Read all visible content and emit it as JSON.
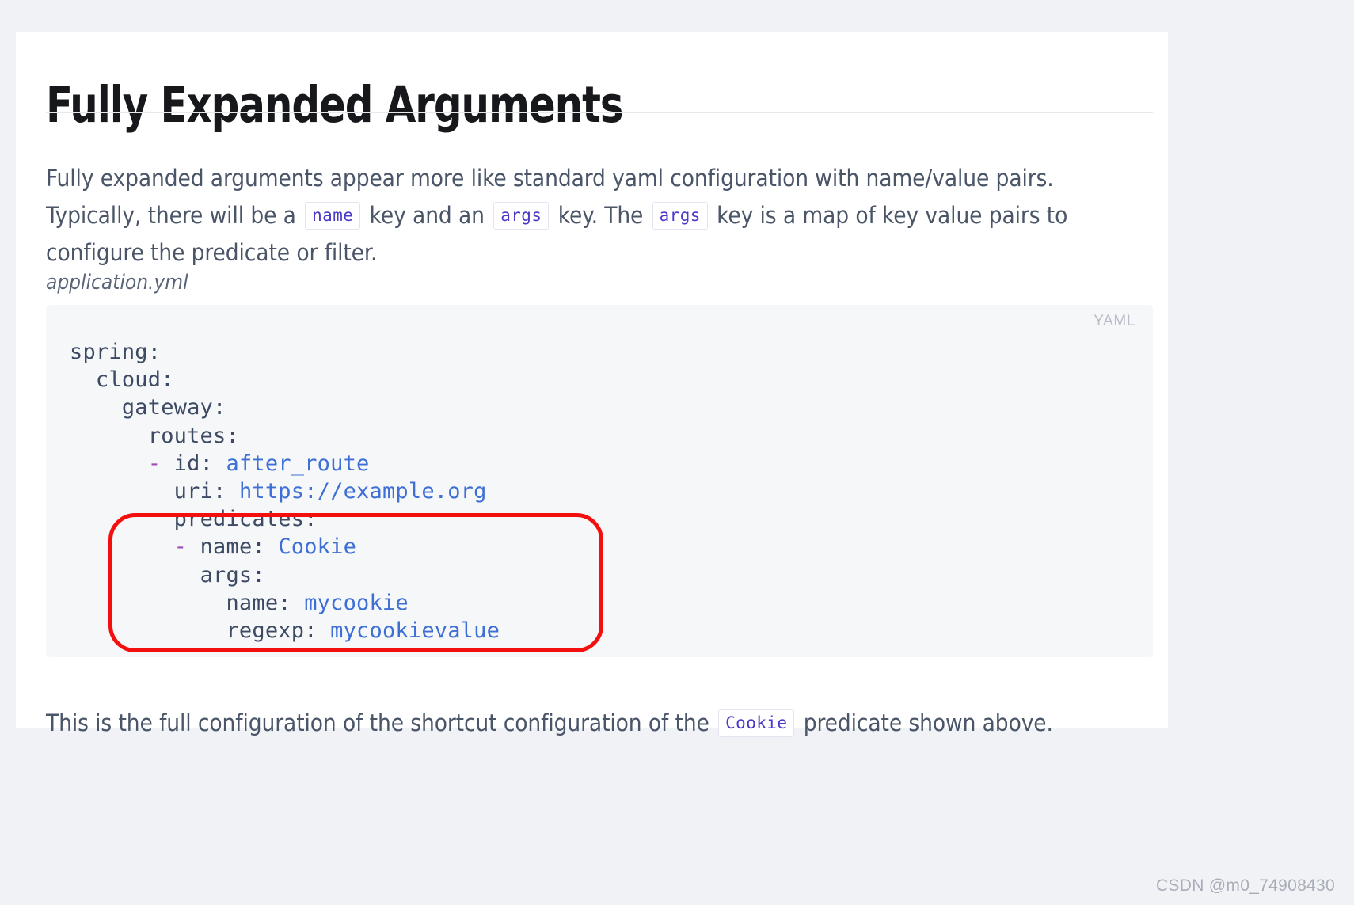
{
  "page": {
    "title": "Fully Expanded Arguments",
    "background_color": "#f1f2f6",
    "card_color": "#ffffff"
  },
  "intro": {
    "part1": "Fully expanded arguments appear more like standard yaml configuration with name/value pairs. Typically, there will be a ",
    "chip1": "name",
    "part2": " key and an ",
    "chip2": "args",
    "part3": " key. The ",
    "chip3": "args",
    "part4": " key is a map of key value pairs to configure the predicate or filter."
  },
  "code": {
    "caption": "application.yml",
    "language_label": "YAML",
    "lines": [
      "spring:",
      "  cloud:",
      "    gateway:",
      "      routes:",
      "      - id: after_route",
      "        uri: https://example.org",
      "        predicates:",
      "        - name: Cookie",
      "          args:",
      "            name: mycookie",
      "            regexp: mycookievalue"
    ],
    "full_text": "spring:\n  cloud:\n    gateway:\n      routes:\n      - id: after_route\n        uri: https://example.org\n        predicates:\n        - name: Cookie\n          args:\n            name: mycookie\n            regexp: mycookievalue"
  },
  "annotation": {
    "shape": "rounded-rectangle",
    "color": "#f40f0f",
    "covers_lines": "- name: Cookie / args: / name: mycookie / regexp: mycookievalue"
  },
  "closing": {
    "part1": "This is the full configuration of the shortcut configuration of the ",
    "chip1": "Cookie",
    "part2": " predicate shown above."
  },
  "watermark": {
    "text": "CSDN @m0_74908430"
  }
}
